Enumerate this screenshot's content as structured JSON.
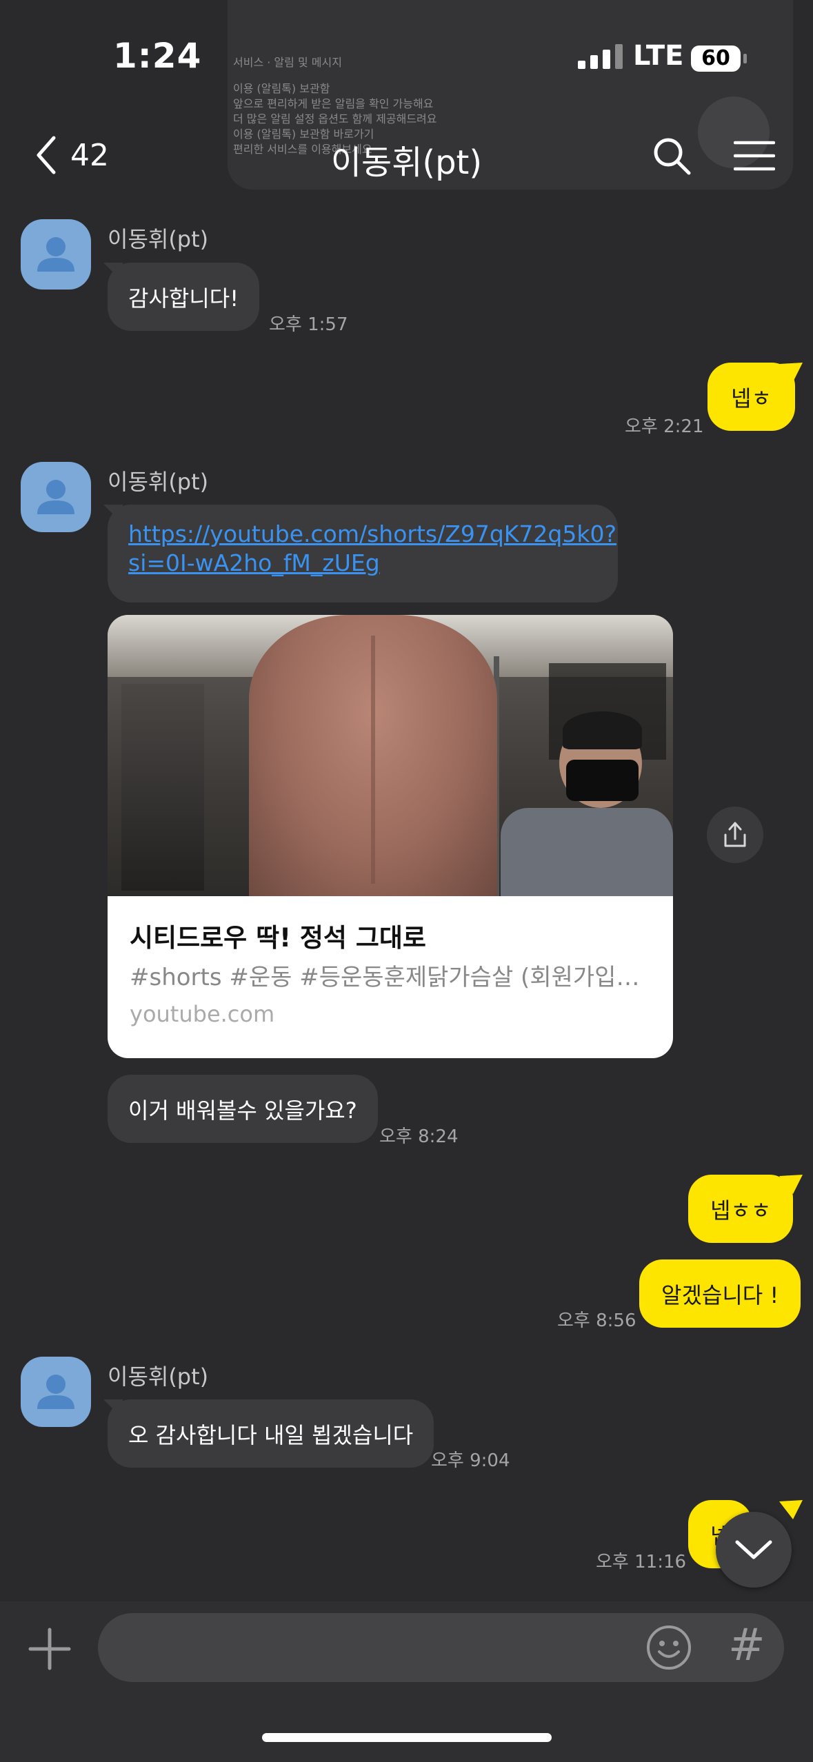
{
  "status_bar": {
    "time": "1:24",
    "network": "LTE",
    "battery": "60"
  },
  "notification_preview": {
    "lines": [
      "서비스 · 알림 및 메시지",
      "이용 (알림톡) 보관함",
      "앞으로 편리하게 받은 알림을 확인 가능해요",
      "더 많은 알림 설정 옵션도 함께 제공해드려요",
      "이용 (알림톡) 보관함 바로가기",
      "편리한 서비스를 이용해보세요"
    ]
  },
  "header": {
    "back_count": "42",
    "title": "이동휘(pt)"
  },
  "messages": {
    "m1": {
      "sender": "이동휘(pt)",
      "text": "감사합니다!",
      "time": "오후 1:57"
    },
    "m2": {
      "text": "넵ㅎ",
      "time": "오후 2:21"
    },
    "m3": {
      "sender": "이동휘(pt)",
      "link_line1": "https://youtube.com/shorts/Z97qK72q5k0?",
      "link_line2": "si=0I-wA2ho_fM_zUEg"
    },
    "card": {
      "title": "시티드로우 딱! 정석 그대로",
      "description": "#shorts #운동 #등운동훈제닭가슴살 (회원가입시...",
      "domain": "youtube.com"
    },
    "m4": {
      "text": "이거 배워볼수 있을가요?",
      "time": "오후 8:24"
    },
    "m5": {
      "text": "넵ㅎㅎ"
    },
    "m6": {
      "text": "알겠습니다 !",
      "time": "오후 8:56"
    },
    "m7": {
      "sender": "이동휘(pt)",
      "text": "오 감사합니다 내일 뵙겠습니다",
      "time": "오후 9:04"
    },
    "m8": {
      "text": "넵",
      "time": "오후 11:16"
    }
  },
  "input_bar": {
    "hash": "#"
  },
  "colors": {
    "background": "#2a2a2c",
    "bubble_in": "#3b3b3d",
    "bubble_out": "#fee500",
    "link": "#3a92f1",
    "avatar": "#7ca9d8"
  }
}
